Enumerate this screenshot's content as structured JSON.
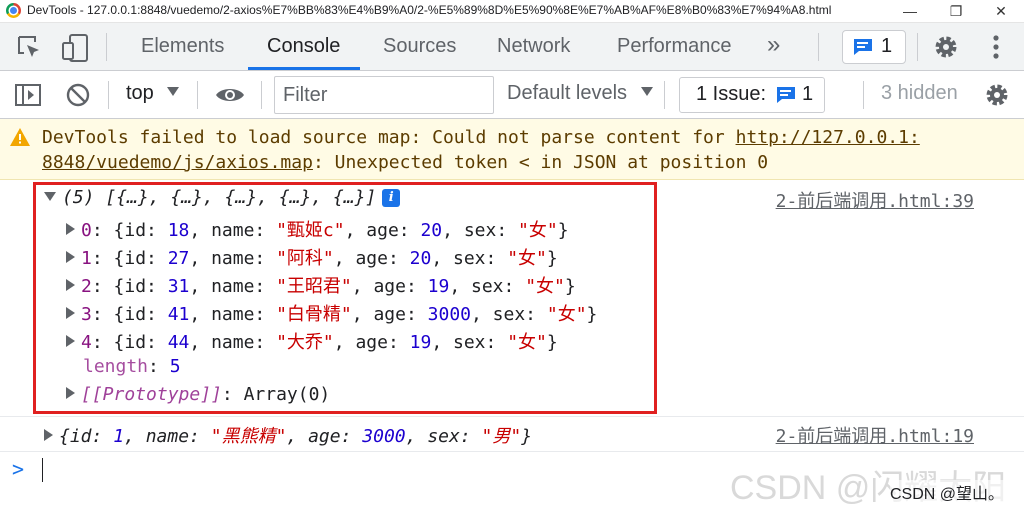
{
  "window": {
    "title": "DevTools - 127.0.0.1:8848/vuedemo/2-axios%E7%BB%83%E4%B9%A0/2-%E5%89%8D%E5%90%8E%E7%AB%AF%E8%B0%83%E7%94%A8.html",
    "minimize": "—",
    "maximize": "❐",
    "close": "✕"
  },
  "tabs": [
    "Elements",
    "Console",
    "Sources",
    "Network",
    "Performance"
  ],
  "active_tab": "Console",
  "more_tabs": "»",
  "issues_badge_count": "1",
  "console_toolbar": {
    "context": "top",
    "filter_placeholder": "Filter",
    "levels": "Default levels",
    "issue_label": "1 Issue:",
    "issue_count": "1",
    "hidden": "3 hidden"
  },
  "warning": {
    "prefix": "DevTools failed to load source map: Could not parse content for ",
    "link1": "http://127.0.0.1:",
    "link2": "8848/vuedemo/js/axios.map",
    "suffix": ": Unexpected token < in JSON at position 0"
  },
  "log1": {
    "summary": "(5) [{…}, {…}, {…}, {…}, {…}]",
    "source": "2-前后端调用.html:39",
    "items": [
      {
        "index": "0",
        "id": "18",
        "name": "\"甄姬c\"",
        "age": "20",
        "sex": "\"女\""
      },
      {
        "index": "1",
        "id": "27",
        "name": "\"阿科\"",
        "age": "20",
        "sex": "\"女\""
      },
      {
        "index": "2",
        "id": "31",
        "name": "\"王昭君\"",
        "age": "19",
        "sex": "\"女\""
      },
      {
        "index": "3",
        "id": "41",
        "name": "\"白骨精\"",
        "age": "3000",
        "sex": "\"女\""
      },
      {
        "index": "4",
        "id": "44",
        "name": "\"大乔\"",
        "age": "19",
        "sex": "\"女\""
      }
    ],
    "length_label": "length",
    "length_value": "5",
    "prototype_label": "[[Prototype]]",
    "prototype_value": "Array(0)"
  },
  "log2": {
    "id": "1",
    "name": "\"黑熊精\"",
    "age": "3000",
    "sex": "\"男\"",
    "source": "2-前后端调用.html:19"
  },
  "prompt_symbol": ">",
  "watermark": {
    "faint": "CSDN @闪耀太阳",
    "main": "CSDN @望山。"
  }
}
